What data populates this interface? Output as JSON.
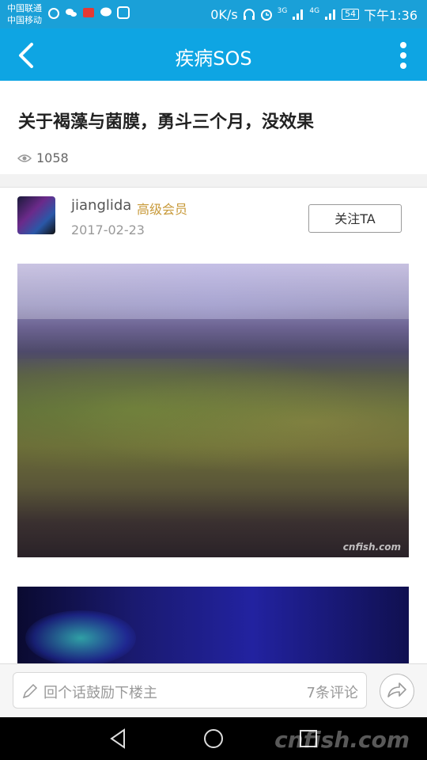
{
  "status_bar": {
    "carrier_1": "中国联通",
    "carrier_2": "中国移动",
    "network_speed": "0K/s",
    "signal_1": "3G",
    "signal_2": "4G",
    "battery": "54",
    "time": "下午1:36"
  },
  "app_bar": {
    "title": "疾病SOS"
  },
  "post": {
    "title": "关于褐藻与菌膜，勇斗三个月，没效果",
    "views": "1058"
  },
  "author": {
    "name": "jianglida",
    "level": "高级会员",
    "date": "2017-02-23",
    "follow_label": "关注TA"
  },
  "images": {
    "photo_1_watermark": "cnfish.com"
  },
  "comment_bar": {
    "placeholder": "回个话鼓励下楼主",
    "count": "7条评论"
  },
  "nav_watermark": "cnfish.com",
  "colors": {
    "status_bar": "#1aa0d8",
    "app_bar": "#0ea5e3",
    "member_level": "#c89a3a"
  }
}
